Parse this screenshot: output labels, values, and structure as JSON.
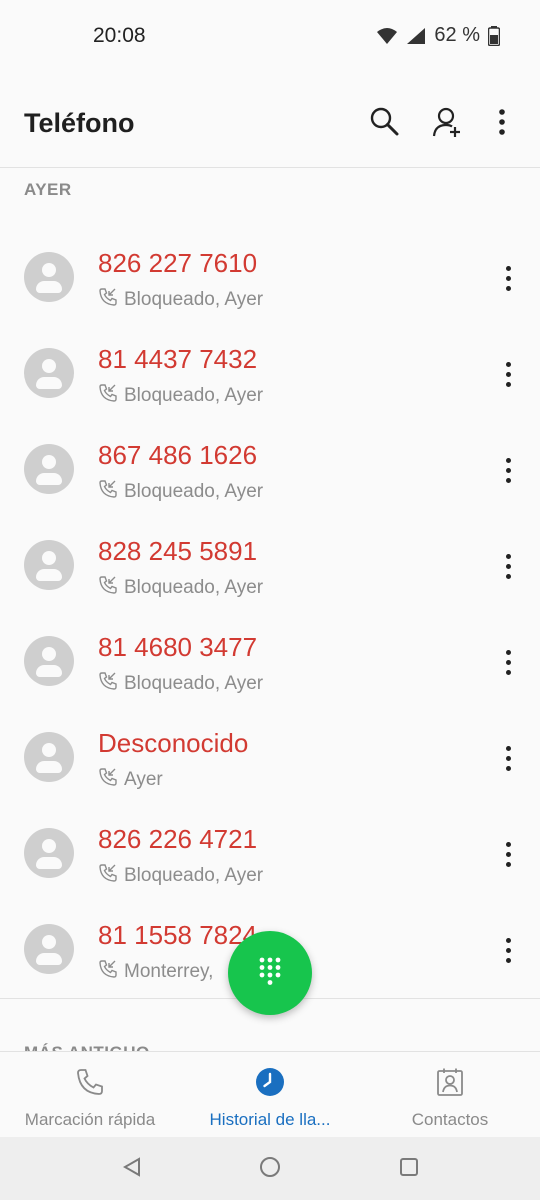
{
  "status": {
    "time": "20:08",
    "battery": "62 %"
  },
  "app_bar": {
    "title": "Teléfono",
    "actions": [
      "search-icon",
      "add-contact-icon",
      "more-vert-icon"
    ]
  },
  "sections": {
    "yesterday": "AYER",
    "older": "MÁS ANTIGUO"
  },
  "calls": [
    {
      "number": "826 227 7610",
      "meta": "Bloqueado, Ayer"
    },
    {
      "number": "81 4437 7432",
      "meta": "Bloqueado, Ayer"
    },
    {
      "number": "867 486 1626",
      "meta": "Bloqueado, Ayer"
    },
    {
      "number": "828 245 5891",
      "meta": "Bloqueado, Ayer"
    },
    {
      "number": "81 4680 3477",
      "meta": "Bloqueado, Ayer"
    },
    {
      "number": "Desconocido",
      "meta": "Ayer"
    },
    {
      "number": "826 226 4721",
      "meta": "Bloqueado, Ayer"
    },
    {
      "number": "81 1558 7824",
      "meta": "Monterrey,"
    }
  ],
  "bottom_nav": [
    {
      "label": "Marcación rápida",
      "icon": "phone-icon",
      "active": false
    },
    {
      "label": "Historial de lla...",
      "icon": "clock-icon",
      "active": true
    },
    {
      "label": "Contactos",
      "icon": "contacts-icon",
      "active": false
    }
  ],
  "colors": {
    "missed_red": "#d23a32",
    "fab_green": "#17c54d",
    "active_blue": "#1a6fc0"
  }
}
